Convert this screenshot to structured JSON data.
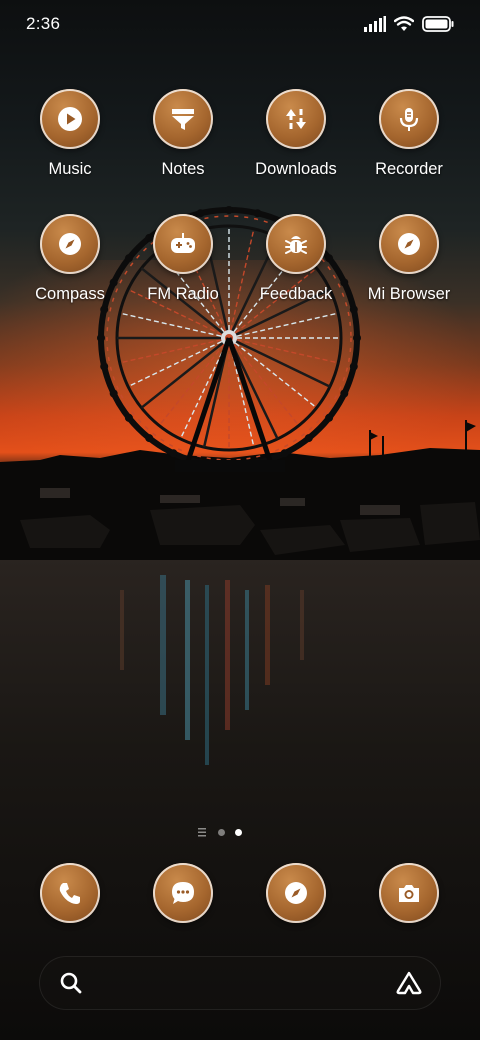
{
  "status_bar": {
    "time": "2:36",
    "icons": [
      "signal-icon",
      "wifi-icon",
      "battery-icon"
    ]
  },
  "apps": [
    {
      "label": "Music",
      "icon": "play-icon"
    },
    {
      "label": "Notes",
      "icon": "notes-icon"
    },
    {
      "label": "Downloads",
      "icon": "download-icon"
    },
    {
      "label": "Recorder",
      "icon": "microphone-icon"
    },
    {
      "label": "Compass",
      "icon": "compass-icon"
    },
    {
      "label": "FM Radio",
      "icon": "gamepad-icon"
    },
    {
      "label": "Feedback",
      "icon": "bug-icon"
    },
    {
      "label": "Mi Browser",
      "icon": "compass-icon"
    }
  ],
  "page_indicator": {
    "pages": 2,
    "current": 2
  },
  "dock": [
    {
      "icon": "phone-icon"
    },
    {
      "icon": "messages-icon"
    },
    {
      "icon": "browser-icon"
    },
    {
      "icon": "camera-icon"
    }
  ],
  "search_bar": {
    "icon": "search-icon",
    "assistant_icon": "assistant-icon"
  },
  "colors": {
    "icon_bg": "#a5662e",
    "sky_glow": "#e0461c",
    "water": "#161412"
  }
}
